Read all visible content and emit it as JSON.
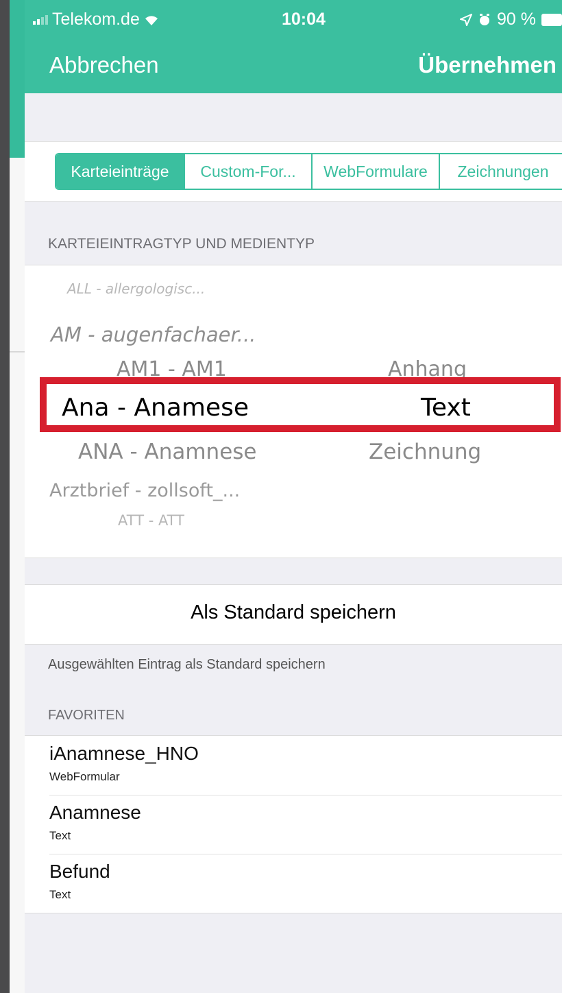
{
  "status_bar": {
    "carrier": "Telekom.de",
    "time": "10:04",
    "battery": "90 %"
  },
  "nav": {
    "cancel": "Abbrechen",
    "apply": "Übernehmen"
  },
  "tabs": [
    {
      "label": "Karteieinträge",
      "active": true
    },
    {
      "label": "Custom-For...",
      "active": false
    },
    {
      "label": "WebFormulare",
      "active": false
    },
    {
      "label": "Zeichnungen",
      "active": false
    }
  ],
  "picker": {
    "header": "KARTEIEINTRAGTYP UND MEDIENTYP",
    "left_items": [
      "ALL - allergologisc...",
      "AM - augenfachaer...",
      "AM1 - AM1",
      "Ana - Anamese",
      "ANA - Anamnese",
      "Arztbrief - zollsoft_...",
      "ATT - ATT"
    ],
    "right_items": [
      "Anhang",
      "Text",
      "Zeichnung"
    ],
    "selected_left": "Ana - Anamese",
    "selected_right": "Text"
  },
  "save_default": {
    "button": "Als Standard speichern",
    "footer": "Ausgewählten Eintrag als Standard speichern"
  },
  "favorites": {
    "header": "FAVORITEN",
    "items": [
      {
        "title": "iAnamnese_HNO",
        "subtitle": "WebFormular"
      },
      {
        "title": "Anamnese",
        "subtitle": "Text"
      },
      {
        "title": "Befund",
        "subtitle": "Text"
      }
    ]
  },
  "colors": {
    "accent": "#3bbf9f",
    "highlight": "#d61f2e"
  }
}
